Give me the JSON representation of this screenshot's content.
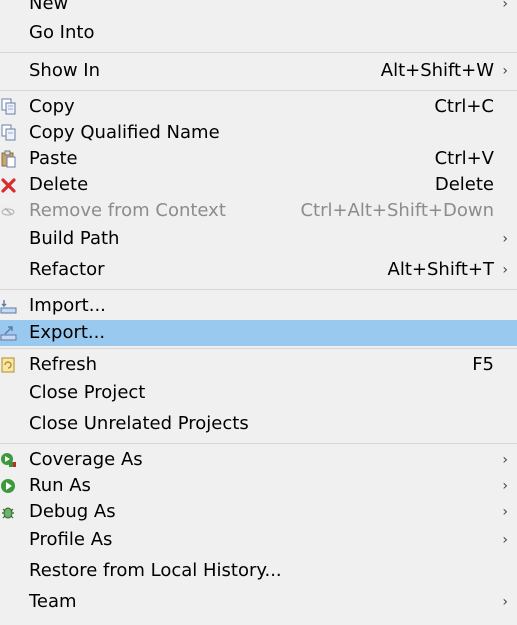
{
  "menu": {
    "new": {
      "label": "New",
      "arrow": "›"
    },
    "go_into": {
      "label": "Go Into"
    },
    "show_in": {
      "label": "Show In",
      "shortcut": "Alt+Shift+W",
      "arrow": "›"
    },
    "copy": {
      "label": "Copy",
      "shortcut": "Ctrl+C",
      "icon": "copy-icon"
    },
    "copy_qualified": {
      "label": "Copy Qualified Name",
      "icon": "copy-qualified-icon"
    },
    "paste": {
      "label": "Paste",
      "shortcut": "Ctrl+V",
      "icon": "paste-icon"
    },
    "delete": {
      "label": "Delete",
      "shortcut": "Delete",
      "icon": "delete-icon"
    },
    "remove_context": {
      "label": "Remove from Context",
      "shortcut": "Ctrl+Alt+Shift+Down",
      "icon": "remove-context-icon",
      "disabled": true
    },
    "build_path": {
      "label": "Build Path",
      "arrow": "›"
    },
    "refactor": {
      "label": "Refactor",
      "shortcut": "Alt+Shift+T",
      "arrow": "›"
    },
    "import": {
      "label": "Import...",
      "icon": "import-icon"
    },
    "export": {
      "label": "Export...",
      "icon": "export-icon",
      "highlighted": true
    },
    "refresh": {
      "label": "Refresh",
      "shortcut": "F5",
      "icon": "refresh-icon"
    },
    "close_project": {
      "label": "Close Project"
    },
    "close_unrelated": {
      "label": "Close Unrelated Projects"
    },
    "coverage_as": {
      "label": "Coverage As",
      "arrow": "›",
      "icon": "coverage-icon"
    },
    "run_as": {
      "label": "Run As",
      "arrow": "›",
      "icon": "run-icon"
    },
    "debug_as": {
      "label": "Debug As",
      "arrow": "›",
      "icon": "debug-icon"
    },
    "profile_as": {
      "label": "Profile As",
      "arrow": "›"
    },
    "restore_history": {
      "label": "Restore from Local History..."
    },
    "team": {
      "label": "Team",
      "arrow": "›"
    }
  },
  "colors": {
    "highlight": "#99c9ef",
    "background": "#f0f0f0",
    "disabled_text": "#8c8c8c",
    "separator": "#d6d6d6"
  }
}
